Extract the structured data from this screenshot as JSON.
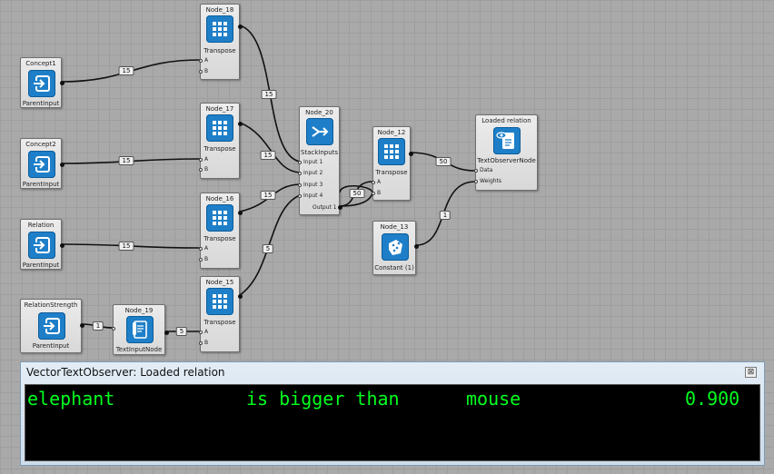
{
  "nodes": {
    "concept1": {
      "title": "Concept1",
      "sub": "ParentInput"
    },
    "concept2": {
      "title": "Concept2",
      "sub": "ParentInput"
    },
    "relation": {
      "title": "Relation",
      "sub": "ParentInput"
    },
    "relation_strength": {
      "title": "RelationStrength",
      "sub": "ParentInput"
    },
    "node19": {
      "title": "Node_19",
      "sub": "TextInputNode"
    },
    "node18": {
      "title": "Node_18",
      "sub": "Transpose",
      "ports": [
        "A",
        "B"
      ]
    },
    "node17": {
      "title": "Node_17",
      "sub": "Transpose",
      "ports": [
        "A",
        "B"
      ]
    },
    "node16": {
      "title": "Node_16",
      "sub": "Transpose",
      "ports": [
        "A",
        "B"
      ]
    },
    "node15": {
      "title": "Node_15",
      "sub": "Transpose",
      "ports": [
        "A",
        "B"
      ]
    },
    "node20": {
      "title": "Node_20",
      "sub": "StackInputs",
      "ports": [
        "Input 1",
        "Input 2",
        "Input 3",
        "Input 4"
      ],
      "output": "Output 1"
    },
    "node12": {
      "title": "Node_12",
      "sub": "Transpose",
      "ports": [
        "A",
        "B"
      ]
    },
    "node13": {
      "title": "Node_13",
      "sub": "Constant (1)"
    },
    "loaded": {
      "title": "Loaded relation",
      "sub": "TextObserverNode",
      "ports": [
        "Data",
        "Weights"
      ]
    }
  },
  "wire_labels": {
    "c1_n18": "15",
    "c2_n17": "15",
    "rel_n16": "15",
    "rs_n19": "1",
    "n19_n15": "5",
    "n18_n20": "15",
    "n17_n20": "15",
    "n16_n20": "15",
    "n15_n20": "5",
    "n20_n12": "50",
    "n12_loaded": "50",
    "n13_loaded": "1"
  },
  "observer": {
    "title": "VectorTextObserver: Loaded relation",
    "close_glyph": "⊠",
    "row": {
      "word1": "elephant",
      "relation": "is bigger than",
      "word2": "mouse",
      "value": "0.900"
    }
  },
  "colors": {
    "tile": "#1e7fc8",
    "terminal_text": "#00ff1e",
    "terminal_bg": "#000000",
    "canvas": "#a9a9a9"
  },
  "icons": {
    "parent_input": "login-arrow-icon",
    "transpose": "grid-icon",
    "stack": "merge-arrows-icon",
    "text_input": "document-pen-icon",
    "constant": "dice-icon",
    "text_observer": "eye-document-icon"
  }
}
